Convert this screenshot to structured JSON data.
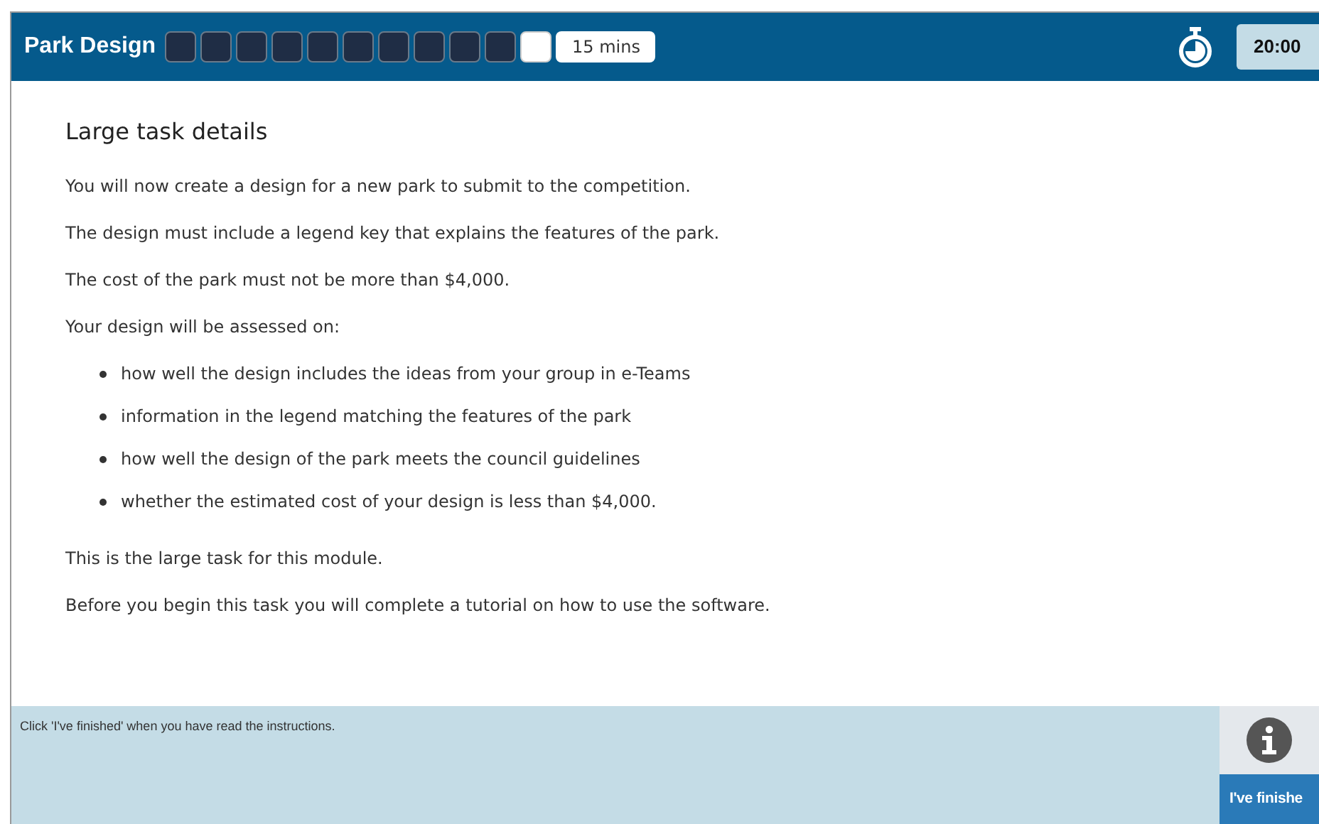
{
  "header": {
    "title": "Park Design",
    "steps": [
      {
        "completed": true
      },
      {
        "completed": true
      },
      {
        "completed": true
      },
      {
        "completed": true
      },
      {
        "completed": true
      },
      {
        "completed": true
      },
      {
        "completed": true
      },
      {
        "completed": true
      },
      {
        "completed": true
      },
      {
        "completed": true
      },
      {
        "completed": false
      }
    ],
    "duration": "15 mins",
    "timer": "20:00"
  },
  "content": {
    "heading": "Large task details",
    "paragraphs_before": [
      "You will now create a design for a new park to submit to the competition.",
      "The design must include a legend key that explains the features of the park.",
      "The cost of the park must not be more than $4,000.",
      "Your design will be assessed on:"
    ],
    "bullets": [
      "how well the design includes the ideas from your group in e-Teams",
      "information in the legend matching the features of the park",
      "how well the design of the park meets the council guidelines",
      "whether the estimated cost of your design is less than $4,000."
    ],
    "paragraphs_after": [
      "This is the large task for this module.",
      "Before you begin this task you will complete a tutorial on how to use the software."
    ]
  },
  "footer": {
    "instruction": "Click 'I've finished' when you have read the instructions.",
    "finish_button": "I've finishe"
  }
}
